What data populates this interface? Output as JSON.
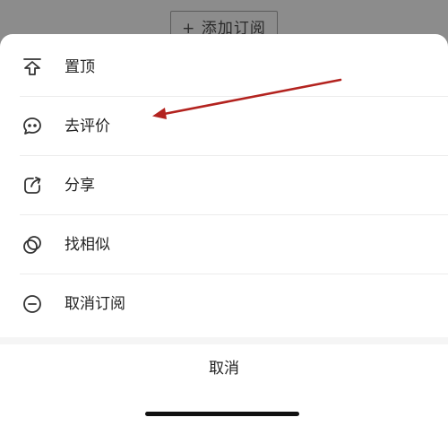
{
  "background": {
    "add_subscription_label": "+ 添加订阅"
  },
  "menu": {
    "items": [
      {
        "label": "置顶",
        "icon": "pin-to-top-icon"
      },
      {
        "label": "去评价",
        "icon": "comment-icon"
      },
      {
        "label": "分享",
        "icon": "share-icon"
      },
      {
        "label": "找相似",
        "icon": "find-similar-icon"
      },
      {
        "label": "取消订阅",
        "icon": "unsubscribe-icon"
      }
    ],
    "cancel_label": "取消"
  },
  "colors": {
    "annotation_arrow": "#b3231f",
    "backdrop": "#8c8c8c",
    "sheet": "#ffffff"
  }
}
